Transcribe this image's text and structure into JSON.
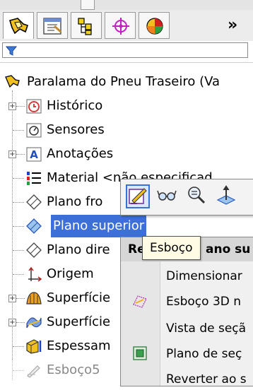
{
  "tabs": {
    "more": "»"
  },
  "tree": {
    "root": "Paralama do Pneu Traseiro  (Va",
    "items": [
      "Histórico",
      "Sensores",
      "Anotações",
      "Material <não especificad",
      "Plano fro",
      "Plano superior",
      "Plano dire",
      "Origem",
      "Superfície",
      "Superfície",
      "Espessam",
      "Esboço5"
    ]
  },
  "menu": {
    "header": "Re",
    "header_suffix": "ano su",
    "items": [
      "Dimensionar",
      "Esboço 3D n",
      "Vista de seçã",
      "Plano de seç",
      "Reverter ao s"
    ]
  },
  "tooltip": "Esboço",
  "colors": {
    "selection": "#3d6fd8",
    "tooltip_bg": "#fffbe4"
  }
}
